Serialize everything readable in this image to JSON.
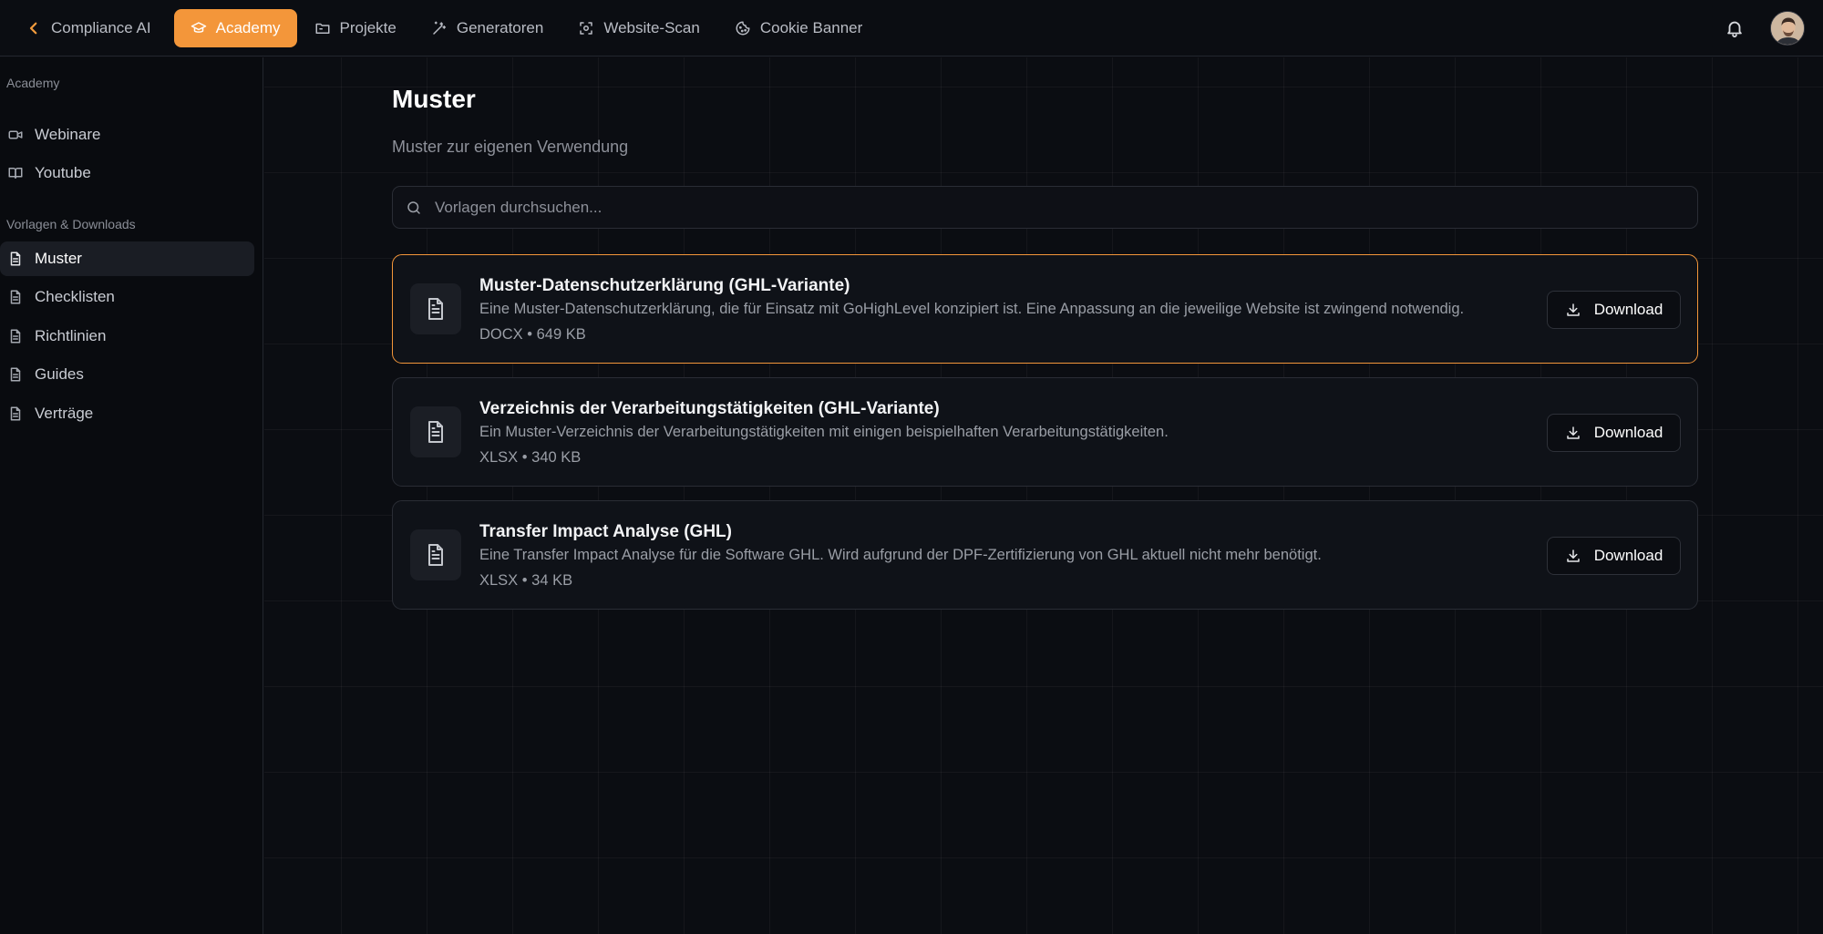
{
  "topnav": {
    "back_label": "Compliance AI",
    "items": [
      {
        "label": "Academy",
        "icon": "graduation-cap-icon",
        "active": true
      },
      {
        "label": "Projekte",
        "icon": "folder-icon",
        "active": false
      },
      {
        "label": "Generatoren",
        "icon": "magic-wand-icon",
        "active": false
      },
      {
        "label": "Website-Scan",
        "icon": "scan-icon",
        "active": false
      },
      {
        "label": "Cookie Banner",
        "icon": "cookie-icon",
        "active": false
      }
    ],
    "accent_color": "#f3963a"
  },
  "sidebar": {
    "sections": [
      {
        "title": "Academy",
        "items": [
          {
            "label": "Webinare",
            "icon": "video-icon"
          },
          {
            "label": "Youtube",
            "icon": "book-open-icon"
          }
        ]
      },
      {
        "title": "Vorlagen & Downloads",
        "items": [
          {
            "label": "Muster",
            "icon": "document-icon",
            "active": true
          },
          {
            "label": "Checklisten",
            "icon": "document-icon"
          },
          {
            "label": "Richtlinien",
            "icon": "document-icon"
          },
          {
            "label": "Guides",
            "icon": "document-icon"
          },
          {
            "label": "Verträge",
            "icon": "document-icon"
          }
        ]
      }
    ]
  },
  "main": {
    "title": "Muster",
    "subtitle": "Muster zur eigenen Verwendung",
    "search_placeholder": "Vorlagen durchsuchen...",
    "download_label": "Download",
    "files": [
      {
        "title": "Muster-Datenschutzerklärung (GHL-Variante)",
        "description": "Eine Muster-Datenschutzerklärung, die für Einsatz mit GoHighLevel konzipiert ist. Eine Anpassung an die jeweilige Website ist zwingend notwendig.",
        "meta": "DOCX • 649 KB",
        "highlighted": true
      },
      {
        "title": "Verzeichnis der Verarbeitungstätigkeiten (GHL-Variante)",
        "description": "Ein Muster-Verzeichnis der Verarbeitungstätigkeiten mit einigen beispielhaften Verarbeitungstätigkeiten.",
        "meta": "XLSX • 340 KB",
        "highlighted": false
      },
      {
        "title": "Transfer Impact Analyse (GHL)",
        "description": "Eine Transfer Impact Analyse für die Software GHL. Wird aufgrund der DPF-Zertifizierung von GHL aktuell nicht mehr benötigt.",
        "meta": "XLSX • 34 KB",
        "highlighted": false
      }
    ]
  }
}
